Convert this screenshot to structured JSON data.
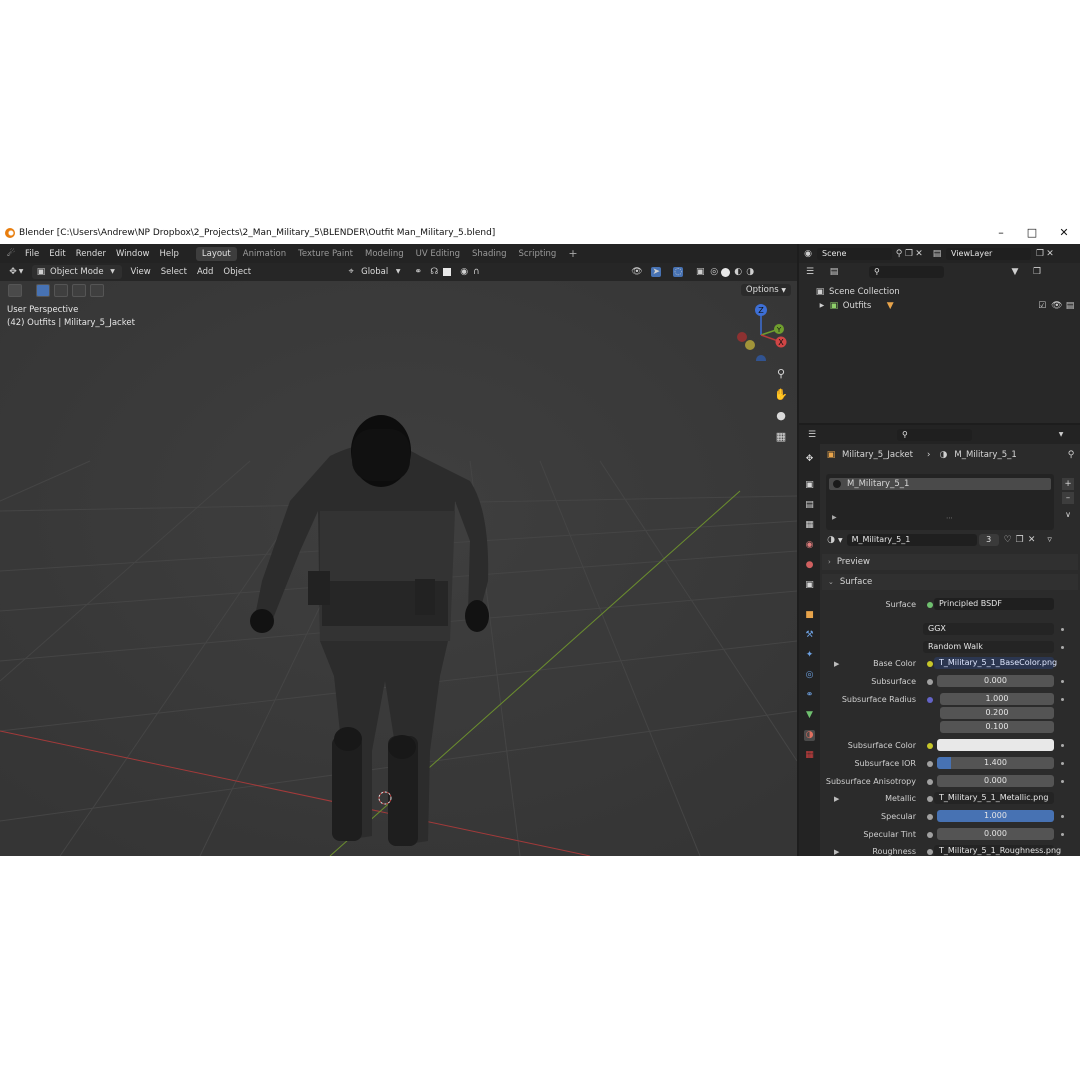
{
  "window": {
    "title": "Blender [C:\\Users\\Andrew\\NP Dropbox\\2_Projects\\2_Man_Military_5\\BLENDER\\Outfit Man_Military_5.blend]"
  },
  "menubar": {
    "items": [
      "File",
      "Edit",
      "Render",
      "Window",
      "Help"
    ]
  },
  "workspaces": [
    "Layout",
    "Animation",
    "Texture Paint",
    "Modeling",
    "UV Editing",
    "Shading",
    "Scripting"
  ],
  "workspace_add": "+",
  "scene": {
    "name": "Scene",
    "view_layer": "ViewLayer"
  },
  "viewport": {
    "mode": "Object Mode",
    "menus": [
      "View",
      "Select",
      "Add",
      "Object"
    ],
    "transform_orientation": "Global",
    "options": "Options",
    "view_name": "User Perspective",
    "object_info": "(42) Outfits | Military_5_Jacket",
    "gizmo": {
      "x": "X",
      "y": "Y",
      "z": "Z"
    }
  },
  "outliner": {
    "scene_collection": "Scene Collection",
    "collection": "Outfits"
  },
  "properties": {
    "object": "Military_5_Jacket",
    "material": "M_Military_5_1",
    "slot": "M_Military_5_1",
    "material_name": "M_Military_5_1",
    "users": "3",
    "preview_label": "Preview",
    "surface_panel": "Surface",
    "surface_label": "Surface",
    "surface_value": "Principled BSDF",
    "distribution": "GGX",
    "subsurface_method": "Random Walk",
    "rows": [
      {
        "label": "Base Color",
        "value": "T_Military_5_1_BaseColor.png"
      },
      {
        "label": "Subsurface",
        "value": "0.000"
      },
      {
        "label": "Subsurface Radius",
        "value": "1.000"
      },
      {
        "label": "",
        "value": "0.200"
      },
      {
        "label": "",
        "value": "0.100"
      },
      {
        "label": "Subsurface Color",
        "value": ""
      },
      {
        "label": "Subsurface IOR",
        "value": "1.400"
      },
      {
        "label": "Subsurface Anisotropy",
        "value": "0.000"
      },
      {
        "label": "Metallic",
        "value": "T_Military_5_1_Metallic.png"
      },
      {
        "label": "Specular",
        "value": "1.000"
      },
      {
        "label": "Specular Tint",
        "value": "0.000"
      },
      {
        "label": "Roughness",
        "value": "T_Military_5_1_Roughness.png"
      }
    ]
  },
  "colors": {
    "accent": "#4772b3",
    "viewport_bg": "#3a3a3a",
    "x_axis": "#b73a3a",
    "y_axis": "#6f9e2e",
    "z_axis": "#3d6fd6"
  }
}
